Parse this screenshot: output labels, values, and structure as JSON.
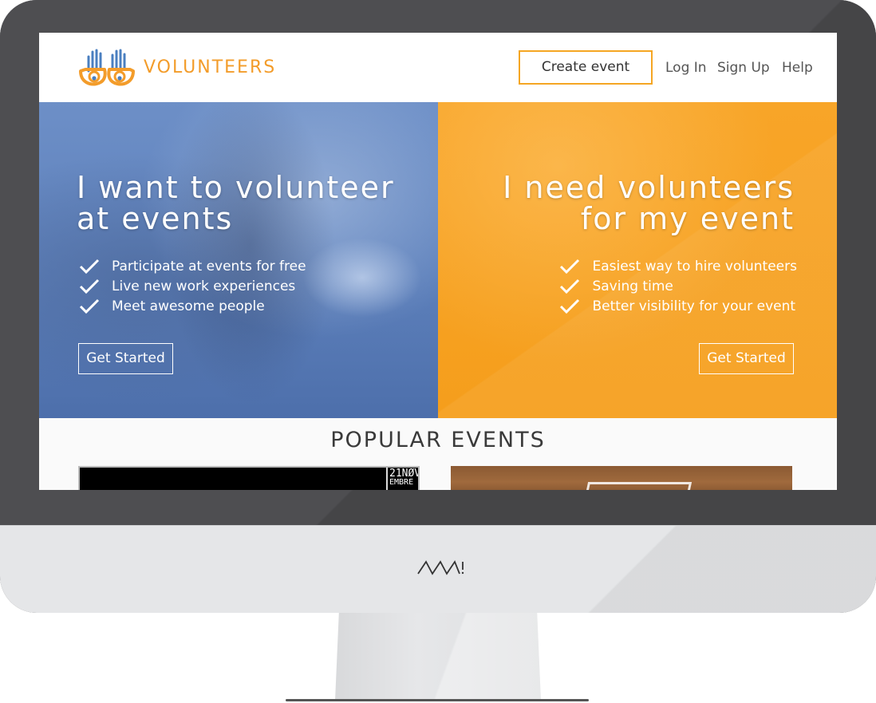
{
  "brand": {
    "name": "VOLUNTEERS",
    "colors": {
      "primary": "#f39c2a",
      "hero_left": "#5d80bb",
      "hero_right": "#f8a528"
    }
  },
  "header": {
    "create_event_label": "Create event",
    "nav": [
      {
        "label": "Log In"
      },
      {
        "label": "Sign Up"
      },
      {
        "label": "Help"
      }
    ]
  },
  "hero": {
    "left": {
      "title_line1": "I want to volunteer",
      "title_line2": "at events",
      "features": [
        "Participate at events for free",
        "Live new work experiences",
        "Meet awesome people"
      ],
      "cta": "Get Started"
    },
    "right": {
      "title_line1": "I need volunteers",
      "title_line2": "for my event",
      "features": [
        "Easiest way to hire volunteers",
        "Saving time",
        "Better visibility for your event"
      ],
      "cta": "Get Started"
    }
  },
  "popular_events": {
    "title": "POPULAR EVENTS",
    "events": [
      {
        "date_day": "21",
        "date_month_line1": "NØV",
        "date_month_line2": "EMBRE"
      },
      {}
    ]
  },
  "device": {
    "logo_icon": "nm-logo"
  },
  "icons": {
    "check": "checkmark-icon",
    "logo": "hands-eyes-logo"
  }
}
